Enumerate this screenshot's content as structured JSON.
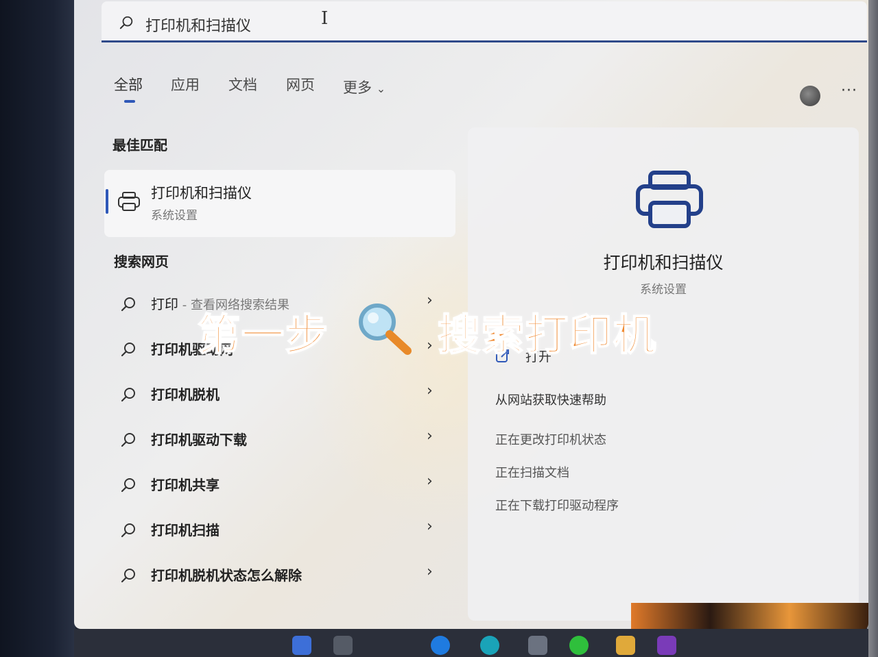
{
  "search": {
    "query": "打印机和扫描仪",
    "cursor_glyph": "I"
  },
  "tabs": [
    {
      "label": "全部",
      "active": true
    },
    {
      "label": "应用",
      "active": false
    },
    {
      "label": "文档",
      "active": false
    },
    {
      "label": "网页",
      "active": false
    },
    {
      "label": "更多",
      "active": false
    }
  ],
  "more_chevron": "⌄",
  "menu_dots": "···",
  "best_match": {
    "section_title": "最佳匹配",
    "title": "打印机和扫描仪",
    "subtitle": "系统设置",
    "icon": "printer-icon"
  },
  "web_search": {
    "section_title": "搜索网页",
    "items": [
      {
        "text": "打印",
        "sub": " - 查看网络搜索结果"
      },
      {
        "text": "打印机驱动网",
        "sub": ""
      },
      {
        "text": "打印机脱机",
        "sub": ""
      },
      {
        "text": "打印机驱动下载",
        "sub": ""
      },
      {
        "text": "打印机共享",
        "sub": ""
      },
      {
        "text": "打印机扫描",
        "sub": ""
      },
      {
        "text": "打印机脱机状态怎么解除",
        "sub": ""
      }
    ],
    "chevron": "›"
  },
  "detail": {
    "title": "打印机和扫描仪",
    "subtitle": "系统设置",
    "open_label": "打开",
    "actions": [
      "从网站获取快速帮助",
      "正在更改打印机状态",
      "正在扫描文档",
      "正在下载打印驱动程序"
    ]
  },
  "overlay": {
    "part1": "第一步",
    "part2": "搜索打印机"
  },
  "colors": {
    "accent": "#2f58b8",
    "overlay_text": "#f08a32"
  }
}
